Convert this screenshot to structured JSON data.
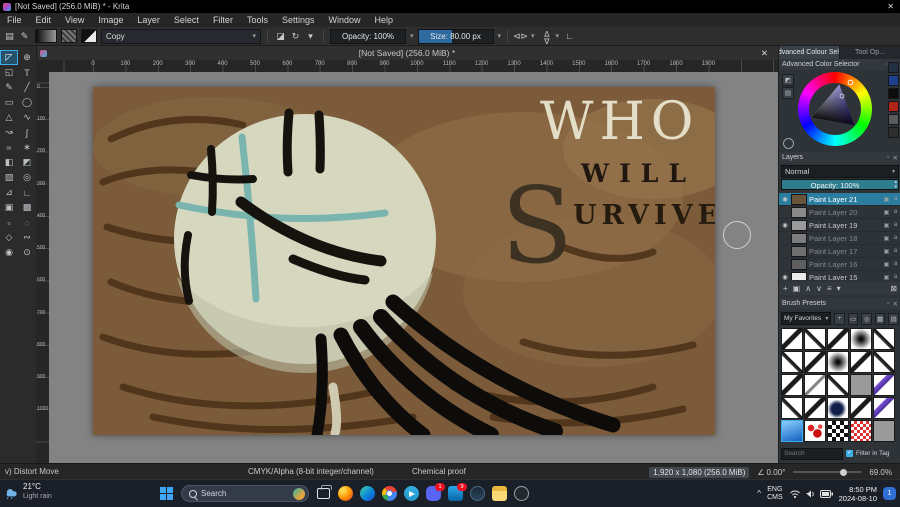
{
  "title_bar": {
    "title": "[Not Saved] (256.0 MiB) * - Krita",
    "close": "✕"
  },
  "menu": [
    "File",
    "Edit",
    "View",
    "Image",
    "Layer",
    "Select",
    "Filter",
    "Tools",
    "Settings",
    "Window",
    "Help"
  ],
  "toolbar": {
    "preset_dropdown": "Copy",
    "opacity": "Opacity: 100%",
    "size": "Size: 80.00 px",
    "size_fill_pct": 45,
    "left_icons": [
      {
        "name": "choose-brush-preset",
        "glyph": "▤"
      },
      {
        "name": "edit-brush-settings",
        "glyph": "✎"
      }
    ],
    "right_icons": [
      {
        "name": "eraser-mode",
        "glyph": "◪"
      },
      {
        "name": "reload-preset",
        "glyph": "↻"
      },
      {
        "name": "preset-caret",
        "glyph": "▾"
      }
    ]
  },
  "doc_tab": {
    "label": "[Not Saved] (256.0 MiB) *",
    "close": "✕"
  },
  "toolbox": [
    {
      "name": "transform",
      "glyph": "◸",
      "active": true
    },
    {
      "name": "move",
      "glyph": "⊕"
    },
    {
      "name": "crop",
      "glyph": "◱"
    },
    {
      "name": "text",
      "glyph": "T"
    },
    {
      "name": "freehand-brush",
      "glyph": "✎"
    },
    {
      "name": "line",
      "glyph": "╱"
    },
    {
      "name": "rectangle",
      "glyph": "▭"
    },
    {
      "name": "ellipse",
      "glyph": "◯"
    },
    {
      "name": "polygon",
      "glyph": "△"
    },
    {
      "name": "polyline",
      "glyph": "∿"
    },
    {
      "name": "bezier-curve",
      "glyph": "↝"
    },
    {
      "name": "freehand-path",
      "glyph": "∫"
    },
    {
      "name": "dynamic-brush",
      "glyph": "≈"
    },
    {
      "name": "multibrush",
      "glyph": "∗"
    },
    {
      "name": "fill",
      "glyph": "◧"
    },
    {
      "name": "enclose-fill",
      "glyph": "◩"
    },
    {
      "name": "gradient",
      "glyph": "▨"
    },
    {
      "name": "color-sampler",
      "glyph": "◎"
    },
    {
      "name": "assistants",
      "glyph": "⊿"
    },
    {
      "name": "measure",
      "glyph": "∟"
    },
    {
      "name": "reference-images",
      "glyph": "▣"
    },
    {
      "name": "smart-patch",
      "glyph": "▩"
    },
    {
      "name": "select-rectangular",
      "glyph": "▫"
    },
    {
      "name": "select-elliptical",
      "glyph": "◌"
    },
    {
      "name": "select-polygonal",
      "glyph": "◇"
    },
    {
      "name": "select-freehand",
      "glyph": "∾"
    },
    {
      "name": "select-contiguous",
      "glyph": "◉"
    },
    {
      "name": "zoom",
      "glyph": "⊙"
    }
  ],
  "rulers": {
    "h_start": 0,
    "h_end": 1900,
    "h_step": 100,
    "v_start": 0,
    "v_end": 1000,
    "v_step": 100
  },
  "artwork": {
    "word_who": "WHO",
    "word_will": "WILL",
    "letter_s": "S",
    "word_survive": "URVIVE?"
  },
  "right_panel": {
    "tabs": [
      {
        "label": "Advanced Colour Sel...",
        "active": true
      },
      {
        "label": "Tool Op...",
        "active": false
      }
    ],
    "color_selector": {
      "title": "Advanced Color Selector",
      "history": [
        "#233042",
        "#1f3f8f",
        "#0c0c0c",
        "#b02418",
        "#5a5a5a",
        "#2e2e2e"
      ]
    },
    "layers": {
      "title": "Layers",
      "blend_mode": "Normal",
      "opacity": "Opacity: 100%",
      "rows": [
        {
          "name": "Paint Layer 21",
          "selected": true,
          "visible": true,
          "thumb": "#6b553a"
        },
        {
          "name": "Paint Layer 20",
          "dim": true,
          "thumb": "#8a8a8a"
        },
        {
          "name": "Paint Layer 19",
          "visible": true,
          "thumb": "#9a9a9a"
        },
        {
          "name": "Paint Layer 18",
          "dim": true,
          "thumb": "#7d7d7d"
        },
        {
          "name": "Paint Layer 17",
          "dim": true,
          "thumb": "#6f6f6f"
        },
        {
          "name": "Paint Layer 16",
          "dim": true,
          "thumb": "#5f5f5f"
        },
        {
          "name": "Paint Layer 15",
          "visible": true,
          "thumb": "#ececec"
        }
      ],
      "toolbar": [
        {
          "name": "add-layer",
          "glyph": "+"
        },
        {
          "name": "duplicate-layer",
          "glyph": "▣"
        },
        {
          "name": "move-layer-up",
          "glyph": "∧"
        },
        {
          "name": "move-layer-down",
          "glyph": "∨"
        },
        {
          "name": "layer-properties",
          "glyph": "≡"
        },
        {
          "name": "layer-menu",
          "glyph": "▾"
        },
        {
          "name": "delete-layer",
          "glyph": "⊠",
          "right": true
        }
      ]
    },
    "brush_presets": {
      "title": "Brush Presets",
      "tag_filter": "My Favorites",
      "search_placeholder": "Search",
      "filter_checkbox": "Filter in Tag",
      "check_glyph": "✓",
      "controls": [
        {
          "name": "add-tag",
          "glyph": "+"
        },
        {
          "name": "tag",
          "glyph": "▭"
        },
        {
          "name": "search-presets",
          "glyph": "◎"
        },
        {
          "name": "grid-view",
          "glyph": "▦"
        },
        {
          "name": "detail-view",
          "glyph": "▤"
        }
      ],
      "cells": [
        "stroke-a",
        "stroke-b",
        "stroke-a",
        "soft",
        "stroke-b",
        "stroke-b",
        "stroke-a",
        "soft",
        "stroke-a",
        "stroke-b",
        "stroke-a",
        "pencil",
        "stroke-b",
        "gray",
        "violet",
        "stroke-b",
        "stroke-a",
        "ink",
        "stroke-a",
        "violet",
        "blue-selected",
        "red-dots",
        "checker",
        "red-checker",
        "gray"
      ]
    }
  },
  "status_bar": {
    "left": "v) Distort Move",
    "colorspace": "CMYK/Alpha (8-bit integer/channel)",
    "proof": "Chemical proof",
    "dims": "1,920 x 1,080 (256.0 MiB)",
    "angle_icon": "∠",
    "angle": "0.00°",
    "zoom": "69.0%"
  },
  "taskbar": {
    "weather": {
      "temp": "21°C",
      "desc": "Light rain"
    },
    "search_placeholder": "Search",
    "apps": [
      {
        "name": "task-view"
      },
      {
        "name": "firefox"
      },
      {
        "name": "edge"
      },
      {
        "name": "chrome"
      },
      {
        "name": "telegram"
      },
      {
        "name": "discord",
        "badge": "1"
      },
      {
        "name": "outlook",
        "badge": "9"
      },
      {
        "name": "steam"
      },
      {
        "name": "file-explorer"
      },
      {
        "name": "obs"
      }
    ],
    "tray": {
      "chevron": "^",
      "lang_top": "ENG",
      "lang_bottom": "CMS",
      "time": "8:50 PM",
      "date": "2024-08-10",
      "badge": "1"
    }
  }
}
